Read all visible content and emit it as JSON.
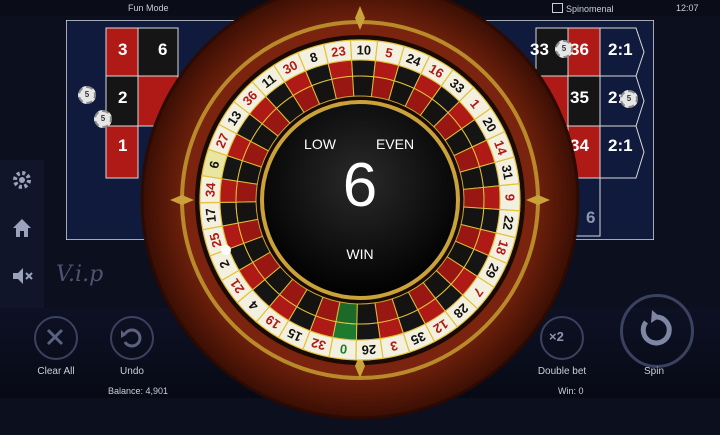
{
  "topbar": {
    "mode": "Fun Mode",
    "provider": "Spinomenal",
    "time": "12:07"
  },
  "table": {
    "left_numbers": [
      "3",
      "6",
      "2",
      "1"
    ],
    "right_numbers": [
      "33",
      "36",
      "35",
      "34",
      "2:1",
      "2:1",
      "2:1",
      "6"
    ],
    "chips": [
      "5",
      "5",
      "5",
      "5"
    ]
  },
  "vip_text": "V.i.p",
  "buttons": {
    "clear_all": "Clear All",
    "undo": "Undo",
    "double_bet": "Double bet",
    "double_bet_badge": "×2",
    "spin": "Spin"
  },
  "status": {
    "balance": "Balance: 4,901",
    "win": "Win: 0"
  },
  "wheel": {
    "result_number": "6",
    "low_label": "LOW",
    "even_label": "EVEN",
    "win_label": "WIN",
    "pocket_order": [
      "0",
      "32",
      "15",
      "19",
      "4",
      "21",
      "2",
      "25",
      "17",
      "34",
      "6",
      "27",
      "13",
      "36",
      "11",
      "30",
      "8",
      "23",
      "10",
      "5",
      "24",
      "16",
      "33",
      "1",
      "20",
      "14",
      "31",
      "9",
      "22",
      "18",
      "29",
      "7",
      "28",
      "12",
      "35",
      "3",
      "26"
    ],
    "winning_pocket": "6"
  },
  "colors": {
    "red": "#b01a16",
    "black": "#151515",
    "green": "#1e7a2e",
    "gold": "#e2c23a",
    "wood": "#7a2410"
  }
}
